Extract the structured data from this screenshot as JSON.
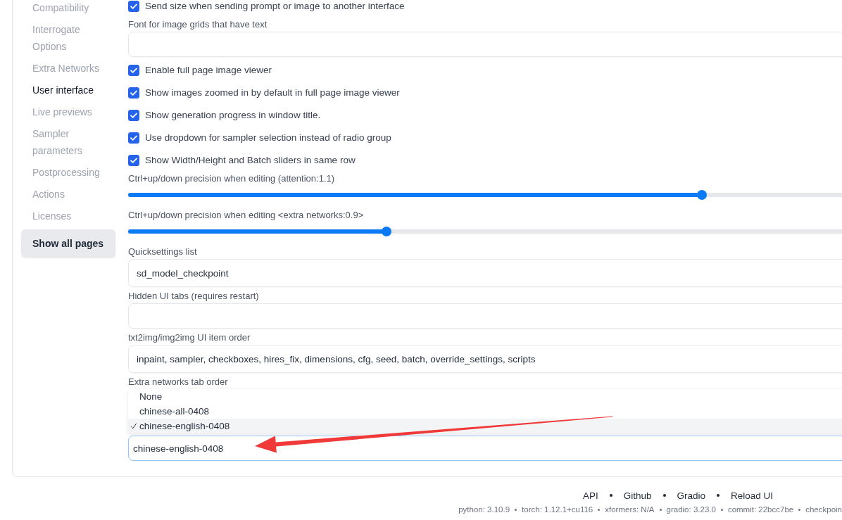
{
  "sidebar": {
    "items": [
      {
        "label": "Compatibility",
        "selected": false
      },
      {
        "label": "Interrogate Options",
        "selected": false
      },
      {
        "label": "Extra Networks",
        "selected": false
      },
      {
        "label": "User interface",
        "selected": true
      },
      {
        "label": "Live previews",
        "selected": false
      },
      {
        "label": "Sampler parameters",
        "selected": false
      },
      {
        "label": "Postprocessing",
        "selected": false
      },
      {
        "label": "Actions",
        "selected": false
      },
      {
        "label": "Licenses",
        "selected": false
      }
    ],
    "show_all_button": "Show all pages"
  },
  "settings": [
    {
      "kind": "checkbox",
      "label": "Send size when sending prompt or image to another interface",
      "checked": true
    },
    {
      "kind": "textbox",
      "label": "Font for image grids that have text"
    },
    {
      "kind": "checkbox",
      "label": "Enable full page image viewer",
      "checked": true
    },
    {
      "kind": "checkbox",
      "label": "Show images zoomed in by default in full page image viewer",
      "checked": true
    },
    {
      "kind": "checkbox",
      "label": "Show generation progress in window title.",
      "checked": true
    },
    {
      "kind": "checkbox",
      "label": "Use dropdown for sampler selection instead of radio group",
      "checked": true
    },
    {
      "kind": "checkbox",
      "label": "Show Width/Height and Batch sliders in same row",
      "checked": true
    },
    {
      "kind": "slider",
      "label": "Ctrl+up/down precision when editing (attention:1.1)",
      "level": 0.774
    },
    {
      "kind": "slider",
      "label": "Ctrl+up/down precision when editing <extra networks:0.9>",
      "level": 0.349
    },
    {
      "kind": "textbox",
      "label": "Quicksettings list",
      "value": "sd_model_checkpoint"
    },
    {
      "kind": "textbox",
      "label": "Hidden UI tabs (requires restart)"
    },
    {
      "kind": "textbox",
      "label": "txt2img/img2img UI item order",
      "value": "inpaint, sampler, checkboxes, hires_fix, dimensions, cfg, seed, batch, override_settings, scripts"
    },
    {
      "kind": "dropdown",
      "label": "Extra networks tab order",
      "options": [
        {
          "label": "None",
          "selected": false
        },
        {
          "label": "chinese-all-0408",
          "selected": false
        },
        {
          "label": "chinese-english-0408",
          "selected": true
        }
      ],
      "value": "chinese-english-0408"
    }
  ],
  "footer": {
    "links": [
      "API",
      "Github",
      "Gradio",
      "Reload UI"
    ],
    "versions": [
      "python: 3.10.9",
      "torch: 1.12.1+cu116",
      "xformers: N/A",
      "gradio: 3.23.0",
      "commit: 22bcc7be",
      "checkpoin"
    ]
  }
}
